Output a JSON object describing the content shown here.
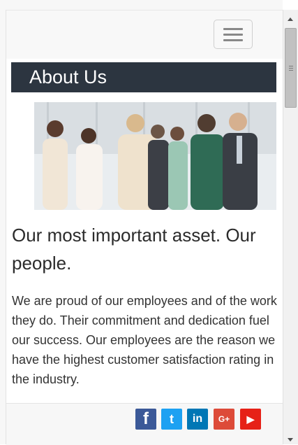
{
  "page": {
    "about_title": "About Us",
    "headline": "Our most important asset. Our people.",
    "body": "We are proud of our employees and of the work they do. Their commitment and dedication fuel our success. Our employees are the reason we have the highest customer satisfaction rating in the industry."
  },
  "nav": {
    "menu_icon": "hamburger-menu-icon"
  },
  "image": {
    "subject": "business team photo"
  },
  "social": [
    {
      "name": "facebook",
      "glyph": "f",
      "color": "#3b5998"
    },
    {
      "name": "twitter",
      "glyph": "t",
      "color": "#1da1f2"
    },
    {
      "name": "linkedin",
      "glyph": "in",
      "color": "#0077b5"
    },
    {
      "name": "google-plus",
      "glyph": "G+",
      "color": "#dd4b39"
    },
    {
      "name": "youtube",
      "glyph": "▶",
      "color": "#e62117"
    }
  ],
  "colors": {
    "about_bar": "#2c3540",
    "footer_bg": "#f7f7f7"
  }
}
